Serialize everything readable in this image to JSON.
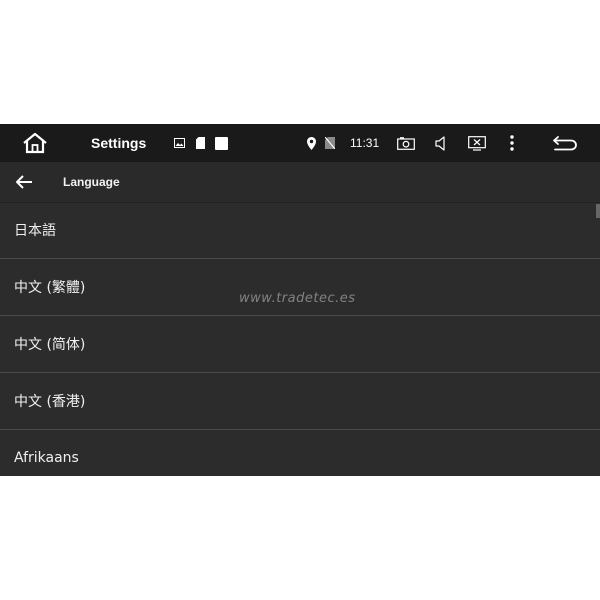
{
  "status_bar": {
    "app_title": "Settings",
    "clock": "11:31",
    "icons": [
      "home-icon",
      "image-icon",
      "sd-card-icon",
      "square-icon",
      "location-icon",
      "no-sim-icon",
      "camera-icon",
      "volume-icon",
      "screen-off-icon",
      "more-vert-icon",
      "back-icon"
    ]
  },
  "toolbar": {
    "title": "Language"
  },
  "languages": [
    {
      "label": "日本語"
    },
    {
      "label": "中文 (繁體)"
    },
    {
      "label": "中文 (简体)"
    },
    {
      "label": "中文 (香港)"
    },
    {
      "label": "Afrikaans"
    }
  ],
  "watermark": "www.tradetec.es",
  "colors": {
    "status_bar_bg": "#1a1a1a",
    "toolbar_bg": "#2a2a2a",
    "list_bg": "#2c2c2c",
    "divider": "#4a4a4a",
    "text": "#f0f0f0"
  }
}
